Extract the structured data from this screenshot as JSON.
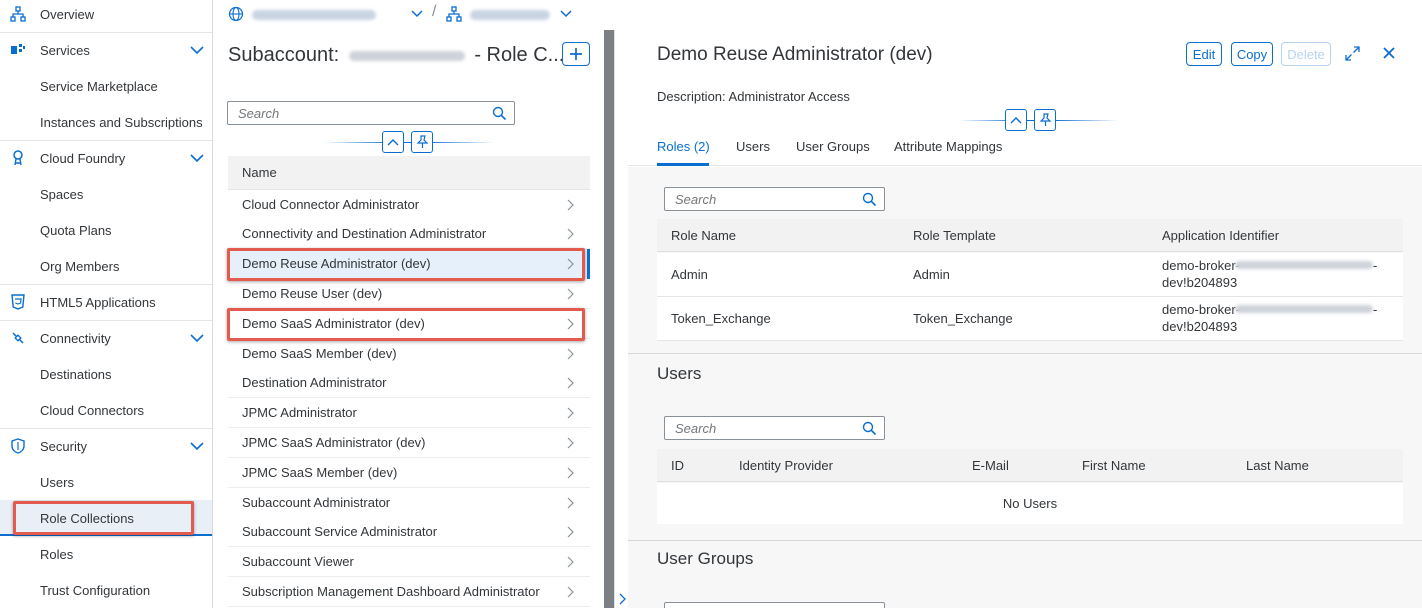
{
  "nav": {
    "items": [
      {
        "label": "Overview",
        "icon": "hierarchy-icon"
      },
      {
        "label": "Services",
        "icon": "services-icon",
        "expandable": true
      },
      {
        "label": "Service Marketplace"
      },
      {
        "label": "Instances and Subscriptions"
      },
      {
        "label": "Cloud Foundry",
        "icon": "cloud-foundry-icon",
        "expandable": true
      },
      {
        "label": "Spaces"
      },
      {
        "label": "Quota Plans"
      },
      {
        "label": "Org Members"
      },
      {
        "label": "HTML5 Applications",
        "icon": "html5-icon"
      },
      {
        "label": "Connectivity",
        "icon": "connectivity-icon",
        "expandable": true
      },
      {
        "label": "Destinations"
      },
      {
        "label": "Cloud Connectors"
      },
      {
        "label": "Security",
        "icon": "shield-icon",
        "expandable": true
      },
      {
        "label": "Users"
      },
      {
        "label": "Role Collections",
        "selected": true
      },
      {
        "label": "Roles"
      },
      {
        "label": "Trust Configuration"
      }
    ]
  },
  "middle": {
    "title_prefix": "Subaccount:",
    "title_suffix": "- Role C...",
    "search_placeholder": "Search",
    "column_header": "Name",
    "rows": [
      "Cloud Connector Administrator",
      "Connectivity and Destination Administrator",
      "Demo Reuse Administrator (dev)",
      "Demo Reuse User (dev)",
      "Demo SaaS Administrator (dev)",
      "Demo SaaS Member (dev)",
      "Destination Administrator",
      "JPMC Administrator",
      "JPMC SaaS Administrator (dev)",
      "JPMC SaaS Member (dev)",
      "Subaccount Administrator",
      "Subaccount Service Administrator",
      "Subaccount Viewer",
      "Subscription Management Dashboard Administrator"
    ]
  },
  "detail": {
    "title": "Demo Reuse Administrator (dev)",
    "edit_label": "Edit",
    "copy_label": "Copy",
    "delete_label": "Delete",
    "description": "Description: Administrator Access",
    "tabs": [
      "Roles (2)",
      "Users",
      "User Groups",
      "Attribute Mappings"
    ],
    "roles": {
      "search_placeholder": "Search",
      "headers": [
        "Role Name",
        "Role Template",
        "Application Identifier"
      ],
      "rows": [
        {
          "name": "Admin",
          "template": "Admin",
          "app_id_1": "demo-broker-",
          "app_id_2": "dev!b204893"
        },
        {
          "name": "Token_Exchange",
          "template": "Token_Exchange",
          "app_id_1": "demo-broker-",
          "app_id_2": "dev!b204893"
        }
      ]
    },
    "users": {
      "title": "Users",
      "search_placeholder": "Search",
      "headers": [
        "ID",
        "Identity Provider",
        "E-Mail",
        "First Name",
        "Last Name"
      ],
      "empty": "No Users"
    },
    "user_groups": {
      "title": "User Groups"
    }
  },
  "colors": {
    "accent": "#0a6ed1",
    "highlight": "#e35b4f",
    "selected_bg": "#e8eff6"
  }
}
